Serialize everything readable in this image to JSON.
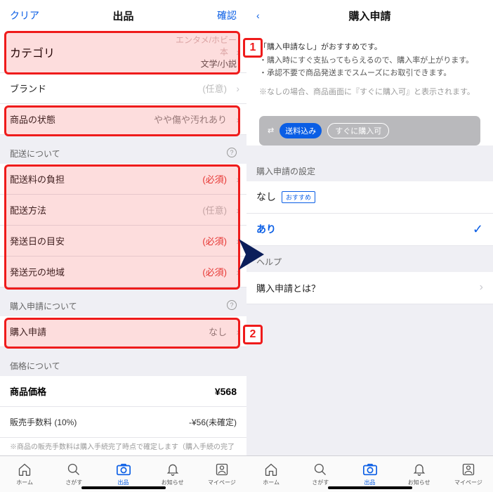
{
  "left": {
    "header": {
      "clear": "クリア",
      "title": "出品",
      "confirm": "確認"
    },
    "category": {
      "label": "カテゴリ",
      "path1": "エンタメ/ホビー",
      "path2": "本",
      "path3": "文学/小説"
    },
    "brand": {
      "label": "ブランド",
      "value": "(任意)"
    },
    "condition": {
      "label": "商品の状態",
      "value": "やや傷や汚れあり"
    },
    "shipSection": "配送について",
    "shipCost": {
      "label": "配送料の負担",
      "value": "(必須)"
    },
    "shipMethod": {
      "label": "配送方法",
      "value": "(任意)"
    },
    "shipDays": {
      "label": "発送日の目安",
      "value": "(必須)"
    },
    "shipRegion": {
      "label": "発送元の地域",
      "value": "(必須)"
    },
    "purchaseSection": "購入申請について",
    "purchase": {
      "label": "購入申請",
      "value": "なし"
    },
    "priceSection": "価格について",
    "price": {
      "label": "商品価格",
      "value": "¥568"
    },
    "fee": {
      "label": "販売手数料 (10%)",
      "value": "-¥56(未確定)"
    },
    "footnote": "※商品の販売手数料は購入手続完了時点で確定します（購入手続の完了"
  },
  "right": {
    "header": {
      "title": "購入申請"
    },
    "info": {
      "line1": "「購入申請なし」がおすすめです。",
      "line2": "・購入時にすぐ支払ってもらえるので、購入率が上がります。",
      "line3": "・承認不要で商品発送までスムーズにお取引できます。",
      "note": "※なしの場合、商品画面に『すぐに購入可』と表示されます。"
    },
    "pills": {
      "p1": "送料込み",
      "p2": "すぐに購入可"
    },
    "settingSection": "購入申請の設定",
    "opt1": {
      "name": "なし",
      "reco": "おすすめ"
    },
    "opt2": {
      "name": "あり"
    },
    "helpSection": "ヘルプ",
    "helpItem": "購入申請とは？"
  },
  "tabs": {
    "home": "ホーム",
    "search": "さがす",
    "sell": "出品",
    "notice": "お知らせ",
    "mypage": "マイページ"
  },
  "badges": {
    "b1": "1",
    "b2": "2"
  }
}
